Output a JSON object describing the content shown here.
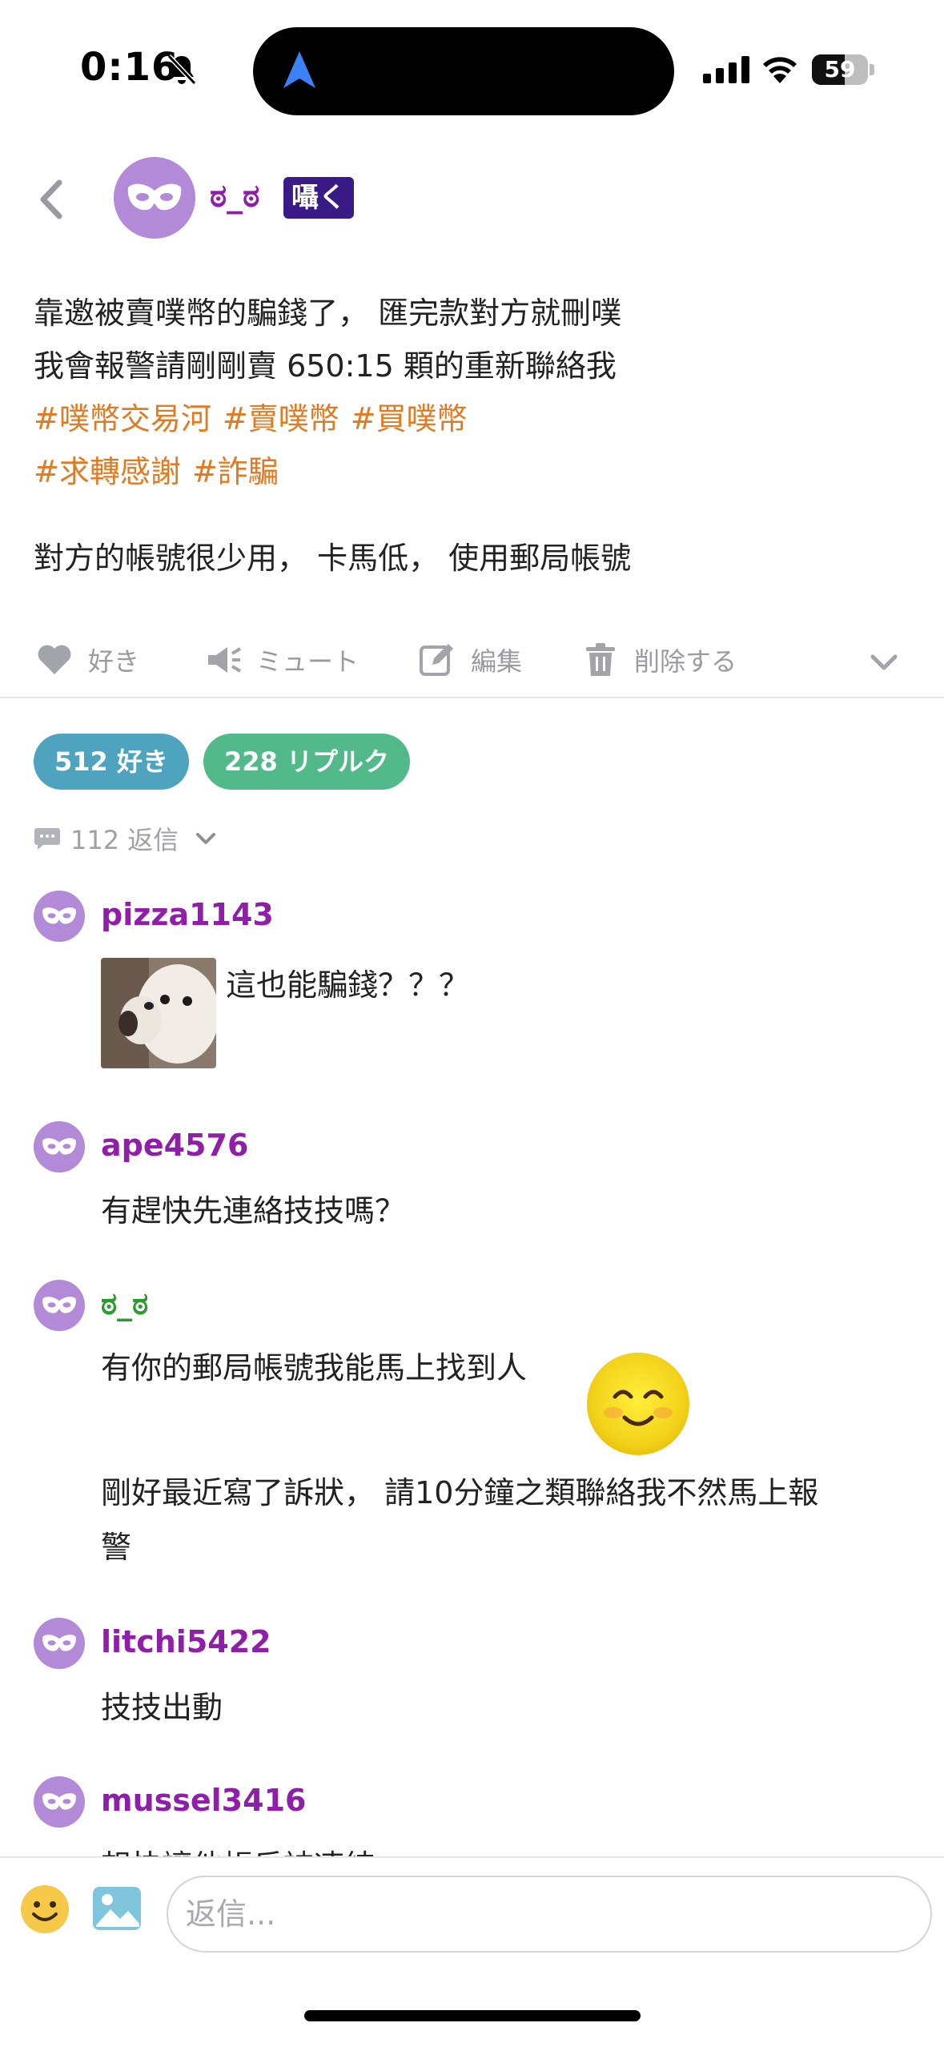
{
  "status_bar": {
    "time": "0:16",
    "battery_level": "59",
    "battery_fraction": 0.59,
    "icons": [
      "bell-slash-icon",
      "location-arrow-icon",
      "cellular-signal-icon",
      "wifi-icon",
      "battery-icon"
    ]
  },
  "header": {
    "back_icon": "chevron-left-icon",
    "author_name": "ಠ_ಠ",
    "verb": "囁く"
  },
  "post": {
    "line1": "靠邀被賣噗幣的騙錢了， 匯完款對方就刪噗",
    "line2": "我會報警請剛剛賣 650:15 顆的重新聯絡我",
    "hashtags_row1": [
      "#噗幣交易河",
      "#賣噗幣",
      "#買噗幣"
    ],
    "hashtags_row2": [
      "#求轉感謝",
      "#詐騙"
    ],
    "extra": "對方的帳號很少用， 卡馬低， 使用郵局帳號"
  },
  "actions": {
    "like": "好き",
    "mute": "ミュート",
    "edit": "編集",
    "delete": "削除する"
  },
  "stats": {
    "likes": "512 好き",
    "replurks": "228 リプルク",
    "replies": "112 返信"
  },
  "colors": {
    "accent_purple": "#8f1fa8",
    "owner_green": "#2c9a2c",
    "hashtag_orange": "#e07b22",
    "likes_pill": "#4ea3bf",
    "replurk_pill": "#52b98a",
    "verb_badge": "#3a1a86",
    "avatar_bg": "#b28ad8"
  },
  "replies": [
    {
      "user": "pizza1143",
      "text": "這也能騙錢？？？",
      "has_image": true
    },
    {
      "user": "ape4576",
      "text": "有趕快先連絡技技嗎？"
    },
    {
      "user": "ಠ_ಠ",
      "text": "有你的郵局帳號我能馬上找到人",
      "text2": "剛好最近寫了訴狀， 請10分鐘之類聯絡我不然馬上報",
      "text3": "警",
      "emoji": "smiling-face-icon"
    },
    {
      "user": "litchi5422",
      "text": "技技出動"
    },
    {
      "user": "mussel3416",
      "text": "想快讓他帳反被凍結"
    }
  ],
  "composer": {
    "placeholder": "返信..."
  }
}
